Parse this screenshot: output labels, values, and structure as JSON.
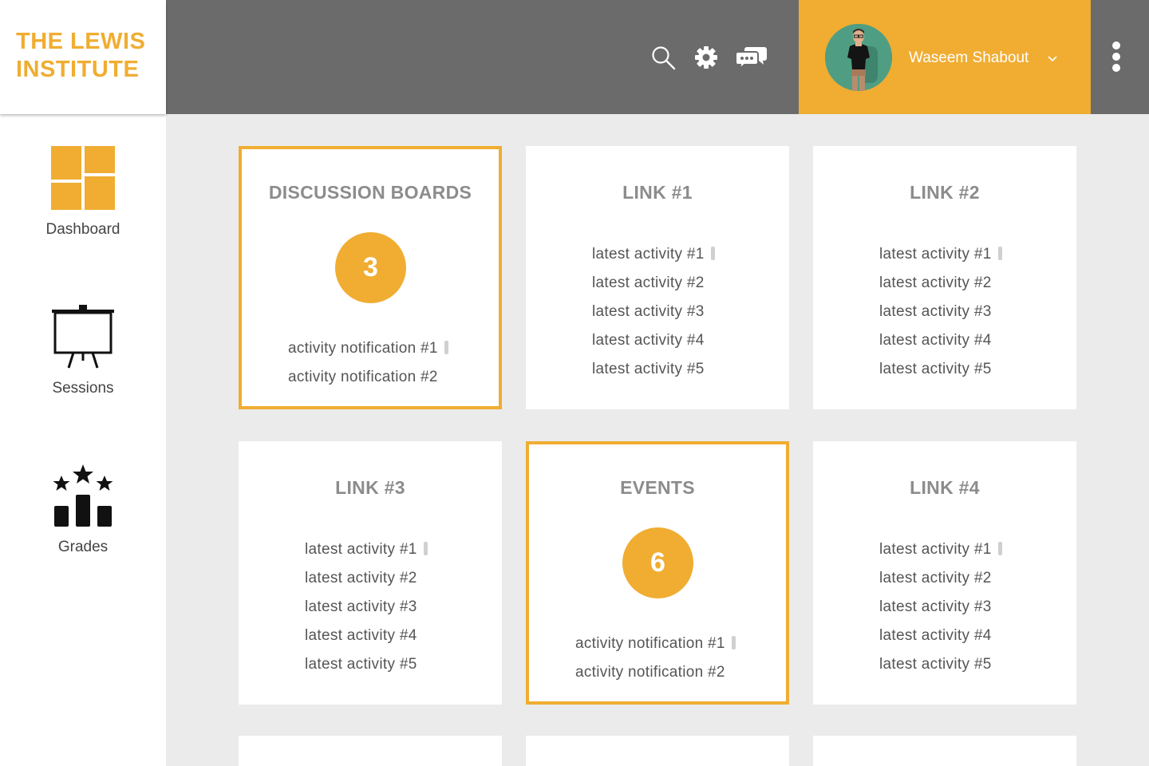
{
  "app": {
    "logo_text": "THE LEWIS\nINSTITUTE"
  },
  "header": {
    "icons": [
      "search-icon",
      "gear-icon",
      "chat-icon"
    ],
    "user": {
      "name": "Waseem Shabout",
      "chevron_icon": "chevron-down-icon"
    },
    "menu_icon": "kebab-menu-icon"
  },
  "colors": {
    "accent": "#f0ad32",
    "topbar": "#6b6b6b",
    "background": "#ebebeb",
    "card_title": "#8c8c8c"
  },
  "sidebar": {
    "items": [
      {
        "label": "Dashboard",
        "icon": "dashboard-grid-icon"
      },
      {
        "label": "Sessions",
        "icon": "presentation-easel-icon"
      },
      {
        "label": "Grades",
        "icon": "grades-podium-icon"
      }
    ]
  },
  "cards": [
    {
      "title": "DISCUSSION BOARDS",
      "badge": "3",
      "items": [
        "activity notification #1",
        "activity notification #2"
      ]
    },
    {
      "title": "LINK #1",
      "items": [
        "latest activity #1",
        "latest activity #2",
        "latest activity #3",
        "latest activity #4",
        "latest activity #5"
      ]
    },
    {
      "title": "LINK #2",
      "items": [
        "latest activity #1",
        "latest activity #2",
        "latest activity #3",
        "latest activity #4",
        "latest activity #5"
      ]
    },
    {
      "title": "LINK #3",
      "items": [
        "latest activity #1",
        "latest activity #2",
        "latest activity #3",
        "latest activity #4",
        "latest activity #5"
      ]
    },
    {
      "title": "EVENTS",
      "badge": "6",
      "items": [
        "activity notification #1",
        "activity notification #2"
      ]
    },
    {
      "title": "LINK #4",
      "items": [
        "latest activity #1",
        "latest activity #2",
        "latest activity #3",
        "latest activity #4",
        "latest activity #5"
      ]
    }
  ]
}
